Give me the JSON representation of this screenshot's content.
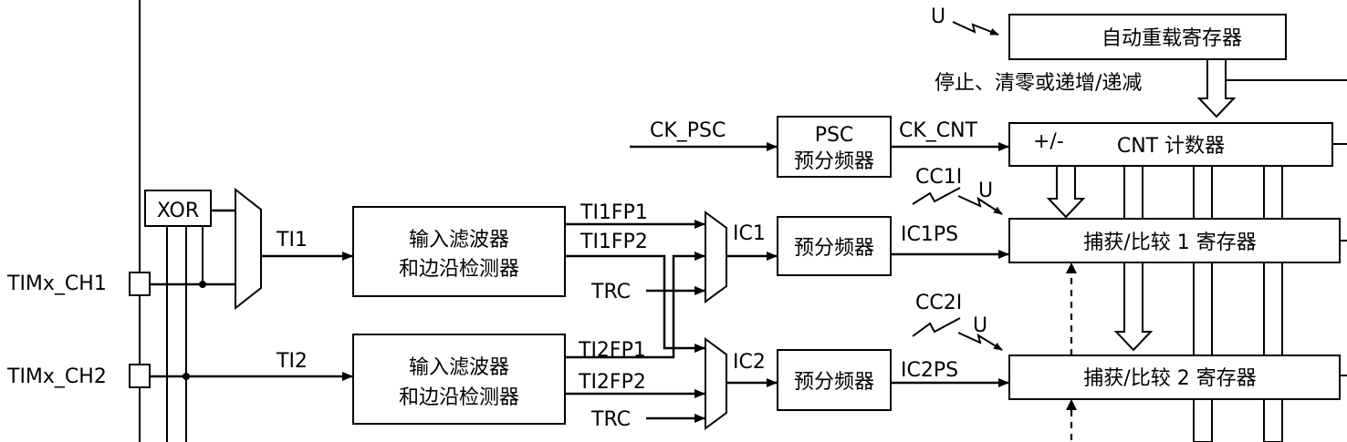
{
  "labels": {
    "u_top": "U",
    "arr_register": "自动重载寄存器",
    "stop_clear": "停止、清零或递增/递减",
    "ck_psc": "CK_PSC",
    "psc_line1": "PSC",
    "psc_line2": "预分频器",
    "ck_cnt": "CK_CNT",
    "cnt_plusminus": "+/-",
    "cnt_counter": "CNT 计数器",
    "cc1i": "CC1I",
    "u_cc1": "U",
    "cc2i": "CC2I",
    "u_cc2": "U",
    "xor": "XOR",
    "ti1": "TI1",
    "ti2": "TI2",
    "filter_line1": "输入滤波器",
    "filter_line2": "和边沿检测器",
    "ti1fp1": "TI1FP1",
    "ti1fp2": "TI1FP2",
    "ti2fp1": "TI2FP1",
    "ti2fp2": "TI2FP2",
    "trc": "TRC",
    "ic1": "IC1",
    "ic2": "IC2",
    "prescaler": "预分频器",
    "ic1ps": "IC1PS",
    "ic2ps": "IC2PS",
    "cc1_register": "捕获/比较 1 寄存器",
    "cc2_register": "捕获/比较 2 寄存器",
    "timx_ch1": "TIMx_CH1",
    "timx_ch2": "TIMx_CH2"
  }
}
